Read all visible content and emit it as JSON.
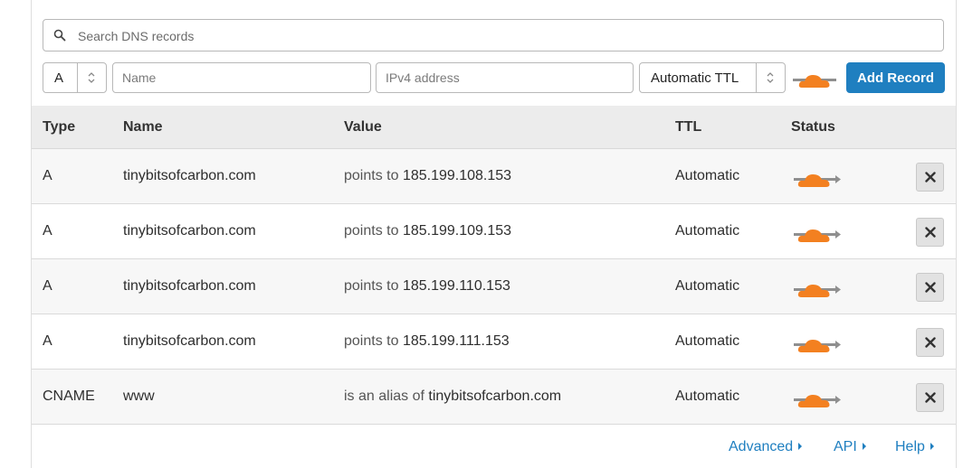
{
  "search": {
    "placeholder": "Search DNS records",
    "value": ""
  },
  "form": {
    "type_value": "A",
    "name_placeholder": "Name",
    "value_placeholder": "IPv4 address",
    "ttl_value": "Automatic TTL",
    "add_label": "Add Record",
    "proxy_icon": "cloud-icon"
  },
  "table": {
    "headers": {
      "type": "Type",
      "name": "Name",
      "value": "Value",
      "ttl": "TTL",
      "status": "Status"
    },
    "rows": [
      {
        "type": "A",
        "name": "tinybitsofcarbon.com",
        "value_prefix": "points to",
        "value": "185.199.108.153",
        "ttl": "Automatic",
        "status_icon": "cloud-icon"
      },
      {
        "type": "A",
        "name": "tinybitsofcarbon.com",
        "value_prefix": "points to",
        "value": "185.199.109.153",
        "ttl": "Automatic",
        "status_icon": "cloud-icon"
      },
      {
        "type": "A",
        "name": "tinybitsofcarbon.com",
        "value_prefix": "points to",
        "value": "185.199.110.153",
        "ttl": "Automatic",
        "status_icon": "cloud-icon"
      },
      {
        "type": "A",
        "name": "tinybitsofcarbon.com",
        "value_prefix": "points to",
        "value": "185.199.111.153",
        "ttl": "Automatic",
        "status_icon": "cloud-icon"
      },
      {
        "type": "CNAME",
        "name": "www",
        "value_prefix": "is an alias of",
        "value": "tinybitsofcarbon.com",
        "ttl": "Automatic",
        "status_icon": "cloud-icon"
      }
    ]
  },
  "footer": {
    "advanced": "Advanced",
    "api": "API",
    "help": "Help"
  },
  "colors": {
    "accent": "#1f7fc0",
    "cloud": "#f38020",
    "header_bg": "#ececec"
  }
}
